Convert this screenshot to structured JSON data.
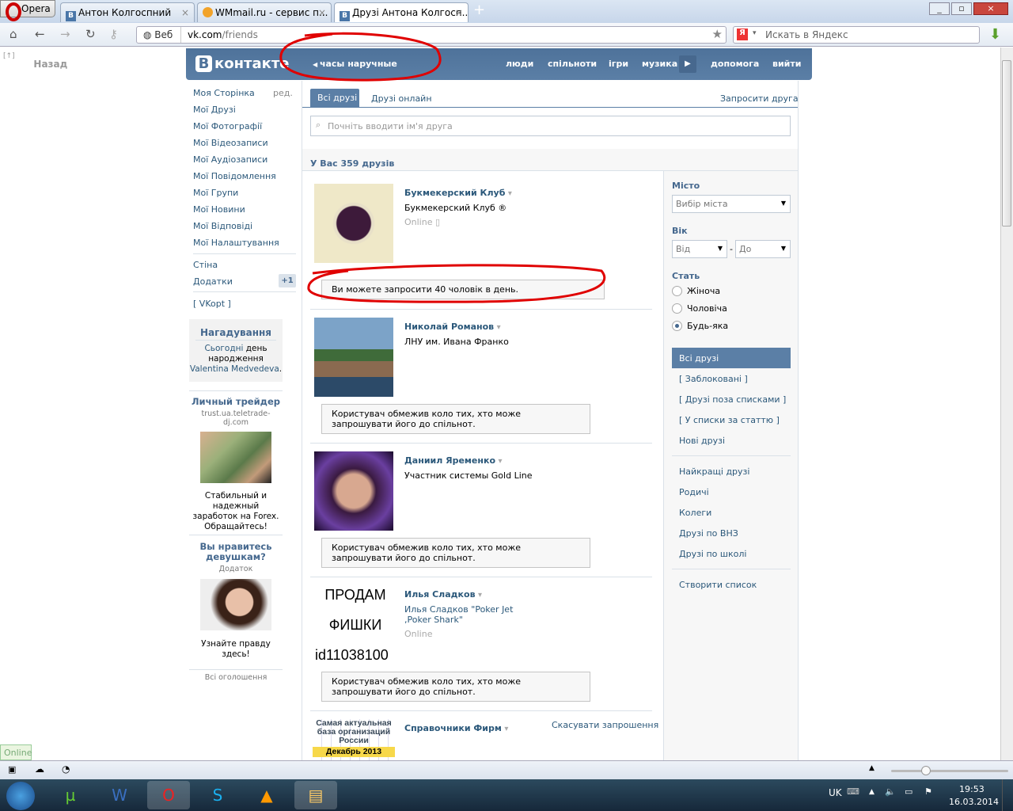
{
  "browser": {
    "opera_label": "Opera",
    "tabs": [
      {
        "label": "Антон Колгоспний",
        "icon": "vk-icon"
      },
      {
        "label": "WMmail.ru - сервис п...",
        "icon": "wmmail-icon"
      },
      {
        "label": "Друзі Антона Колгосп...",
        "icon": "vk-icon",
        "active": true
      }
    ],
    "web_label": "Веб",
    "url_domain": "vk.com",
    "url_path": "/friends",
    "search_placeholder": "Искать в Яндекс",
    "back_label": "Назад",
    "back_marker": "[↑]"
  },
  "vk": {
    "logo": "контакте",
    "logo_letter": "B",
    "product_search": "часы наручные",
    "nav": [
      "люди",
      "спільноти",
      "ігри",
      "музика",
      "допомога",
      "вийти"
    ],
    "left_menu": [
      {
        "label": "Моя Сторінка",
        "extra": "ред."
      },
      {
        "label": "Мої Друзі"
      },
      {
        "label": "Мої Фотографії"
      },
      {
        "label": "Мої Відеозаписи"
      },
      {
        "label": "Мої Аудіозаписи"
      },
      {
        "label": "Мої Повідомлення"
      },
      {
        "label": "Мої Групи"
      },
      {
        "label": "Мої Новини"
      },
      {
        "label": "Мої Відповіді"
      },
      {
        "label": "Мої Налаштування"
      },
      {
        "label": "Стіна"
      },
      {
        "label": "Додатки",
        "badge": "+1"
      },
      {
        "label": "[ VKopt ]"
      }
    ],
    "reminder": {
      "title": "Нагадування",
      "text1": "Сьогодні",
      "text2": " день народження",
      "name": "Valentina Medvedeva",
      "end": "."
    },
    "ads": [
      {
        "title": "Личный трейдер",
        "domain": "trust.ua.teletrade-dj.com",
        "text": "Стабильный и надежный заработок на Forex. Обращайтесь!"
      },
      {
        "title": "Вы нравитесь девушкам?",
        "domain": "Додаток",
        "text": "Узнайте правду здесь!"
      }
    ],
    "all_ads": "Всі оголошення",
    "tabs": [
      "Всі друзі",
      "Друзі онлайн"
    ],
    "invite_friend": "Запросити друга",
    "search_placeholder": "Почніть вводити ім'я друга",
    "friends_count": "У Вас 359 друзів",
    "friends": [
      {
        "name": "Букмекерский Клуб",
        "sub": "Букмекерский Клуб ®",
        "status": "Online",
        "note": "Ви можете запросити 40 чоловік в день."
      },
      {
        "name": "Николай Романов",
        "sub": "ЛНУ им. Ивана Франко",
        "note": "Користувач обмежив коло тих, хто може запрошувати його до спільнот."
      },
      {
        "name": "Даниил Яременко",
        "sub": "Участник системы Gold Line",
        "note": "Користувач обмежив коло тих, хто може запрошувати його до спільнот."
      },
      {
        "name": "Илья Сладков",
        "sub": "Илья Сладков \"Poker Jet ,Poker Shark\"",
        "status": "Online",
        "note": "Користувач обмежив коло тих, хто може запрошувати його до спільнот.",
        "photo_text": [
          "ПРОДАМ",
          "ФИШКИ",
          "id11038100"
        ]
      },
      {
        "name": "Справочники Фирм",
        "action": "Скасувати запрошення",
        "photo_text": [
          "Самая актуальная база организаций России",
          "Декабрь 2013"
        ]
      }
    ],
    "filters": {
      "city_label": "Місто",
      "city_value": "Вибір міста",
      "age_label": "Вік",
      "age_from": "Від",
      "age_to": "До",
      "age_dash": "-",
      "gender_label": "Стать",
      "genders": [
        "Жіноча",
        "Чоловіча",
        "Будь-яка"
      ],
      "gender_selected": 2,
      "lists": [
        "Всі друзі",
        "[ Заблоковані ]",
        "[ Друзі поза списками ]",
        "[ У списки за статтю ]",
        "Нові друзі",
        "Найкращі друзі",
        "Родичі",
        "Колеги",
        "Друзі по ВНЗ",
        "Друзі по школі",
        "Створити список"
      ]
    }
  },
  "status": {
    "online": "Online",
    "zoom_fraction": 0.2
  },
  "taskbar": {
    "lang": "UK",
    "time": "19:53",
    "date": "16.03.2014"
  },
  "colors": {
    "vk_blue": "#5b7fa6",
    "link": "#2b587a",
    "annotation": "#e00000"
  }
}
